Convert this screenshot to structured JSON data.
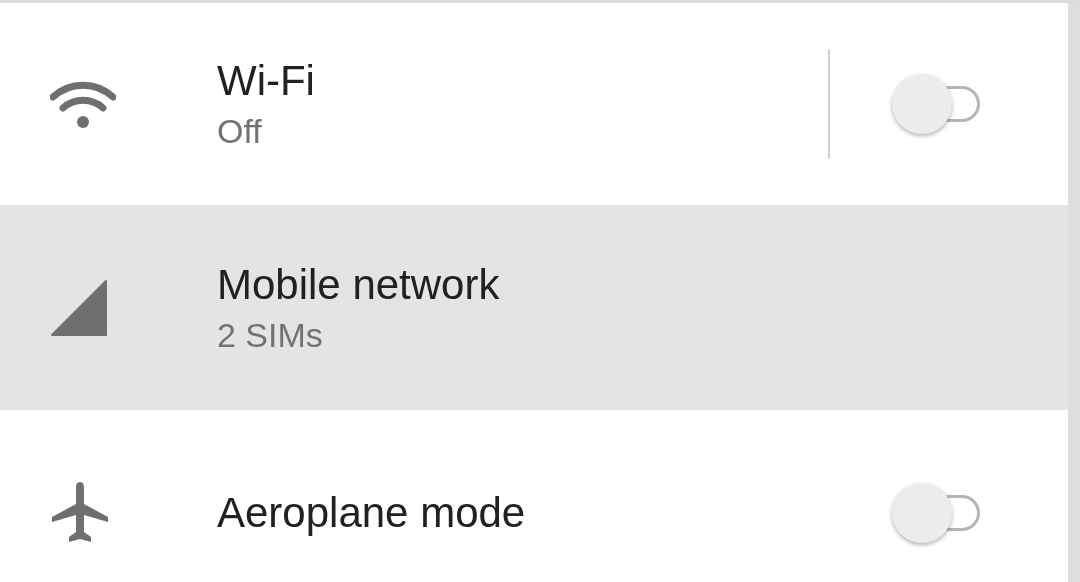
{
  "rows": [
    {
      "kind": "split_switch",
      "title": "Wi-Fi",
      "subtitle": "Off",
      "selected": false,
      "on": false
    },
    {
      "kind": "link",
      "title": "Mobile network",
      "subtitle": "2 SIMs",
      "selected": true
    },
    {
      "kind": "switch",
      "title": "Aeroplane mode",
      "selected": false,
      "on": false
    }
  ]
}
